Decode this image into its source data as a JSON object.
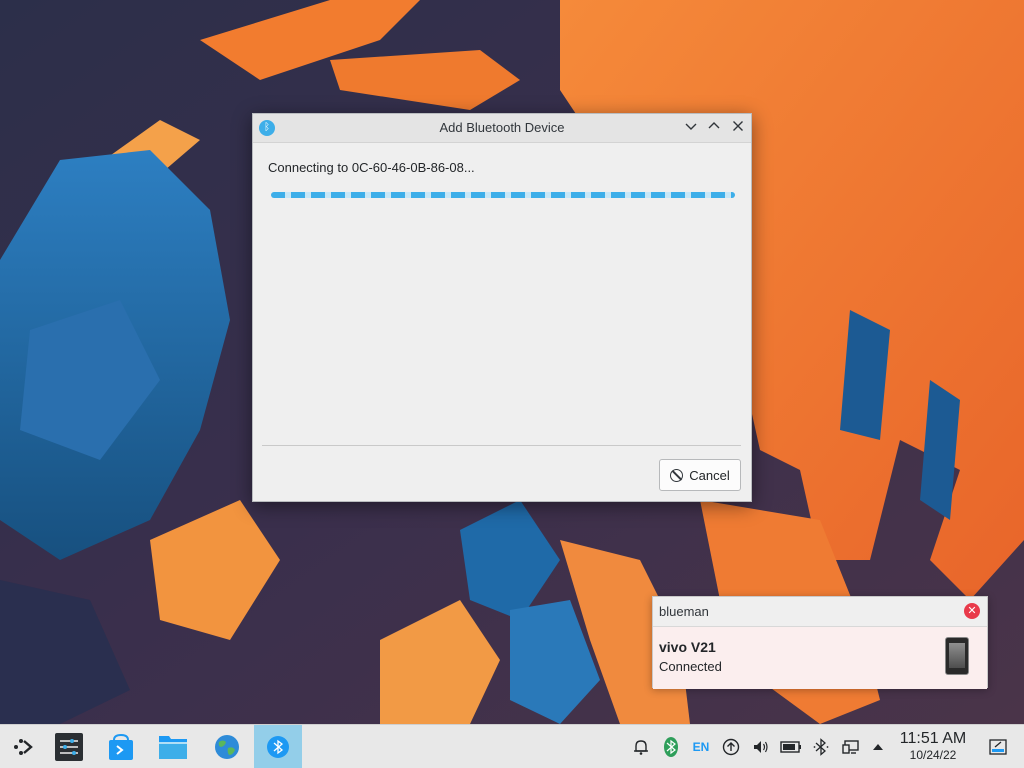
{
  "dialog": {
    "title": "Add Bluetooth Device",
    "status_text": "Connecting to 0C-60-46-0B-86-08...",
    "cancel_label": "Cancel",
    "titlebar_buttons": [
      "minimize-icon",
      "maximize-icon",
      "close-icon"
    ]
  },
  "notification": {
    "app_name": "blueman",
    "title": "vivo V21",
    "body": "Connected"
  },
  "taskbar": {
    "launchers": [
      "application-launcher-icon",
      "system-settings-icon",
      "discover-icon",
      "file-manager-icon",
      "web-browser-icon",
      "bluetooth-manager-icon"
    ],
    "tray": {
      "language": "EN"
    },
    "clock": {
      "time": "11:51 AM",
      "date": "10/24/22"
    }
  },
  "colors": {
    "accent": "#3daee9",
    "wallpaper_orange": "#f07a2e",
    "wallpaper_blue": "#1b5f9e",
    "close_red": "#e93a4a"
  }
}
